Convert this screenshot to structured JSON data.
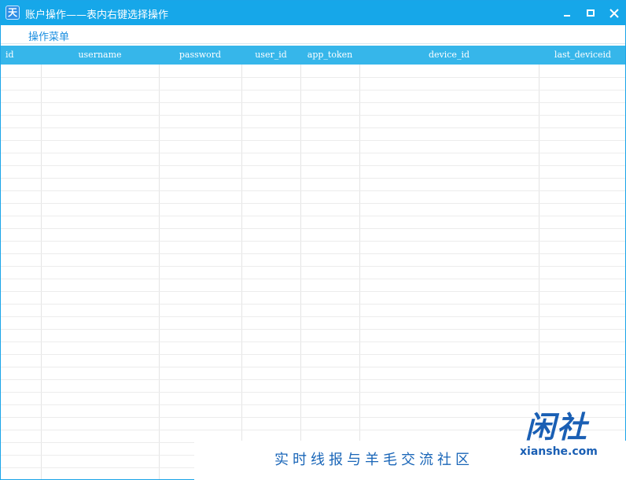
{
  "window": {
    "title": "账户操作——表内右键选择操作",
    "icon_glyph": "天"
  },
  "menu": {
    "items": [
      {
        "label": "操作菜单"
      }
    ]
  },
  "table": {
    "columns": [
      "id",
      "username",
      "password",
      "user_id",
      "app_token",
      "device_id",
      "last_deviceid"
    ],
    "rows": []
  },
  "watermark": {
    "slogan": "实时线报与羊毛交流社区",
    "logo_cn": "闲社",
    "logo_en": "xianshe.com"
  },
  "colors": {
    "titlebar": "#16a7e9",
    "header": "#36b6ea",
    "menu_text": "#1a8ee0",
    "watermark": "#1a5fb4"
  }
}
